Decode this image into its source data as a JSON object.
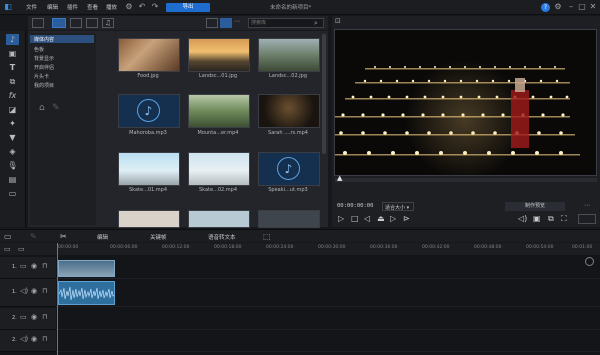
{
  "menu": {
    "file": "文件",
    "edit": "编辑",
    "plugin": "插件",
    "view": "查看",
    "playback": "播放"
  },
  "toolbar": {
    "export_label": "导出"
  },
  "window": {
    "title": "未命名的新项目*"
  },
  "library": {
    "search_placeholder": "搜索库",
    "tree": [
      "媒体内容",
      "色板",
      "背景显示",
      "开启伴侣",
      "片头卡",
      "我的项目"
    ],
    "items": [
      {
        "name": "Food.jpg"
      },
      {
        "name": "Landsc...01.jpg"
      },
      {
        "name": "Landsc...02.jpg"
      },
      {
        "name": "Mahoroba.mp3"
      },
      {
        "name": "Mounta...er.mp4"
      },
      {
        "name": "Sarah ....rs.mp4"
      },
      {
        "name": "Skate...01.mp4"
      },
      {
        "name": "Skate...02.mp4"
      },
      {
        "name": "Speaki...ut.mp3"
      }
    ]
  },
  "preview": {
    "timecode": "00:00:00:00",
    "quality": "适合大小",
    "mode_label": "制作预览"
  },
  "timeline": {
    "tools": {
      "edit": "编辑",
      "keyframe": "关键帧",
      "subtitle": "语音转文本"
    },
    "ruler": [
      "00:00:00",
      "00:00:06:00",
      "00:00:12:00",
      "00:00:18:00",
      "00:00:24:00",
      "00:00:30:00",
      "00:00:36:00",
      "00:00:42:00",
      "00:00:48:00",
      "00:00:54:00",
      "00:01:00"
    ],
    "tracks": [
      {
        "label": "1."
      },
      {
        "label": "1."
      },
      {
        "label": "2."
      },
      {
        "label": "2."
      }
    ]
  }
}
